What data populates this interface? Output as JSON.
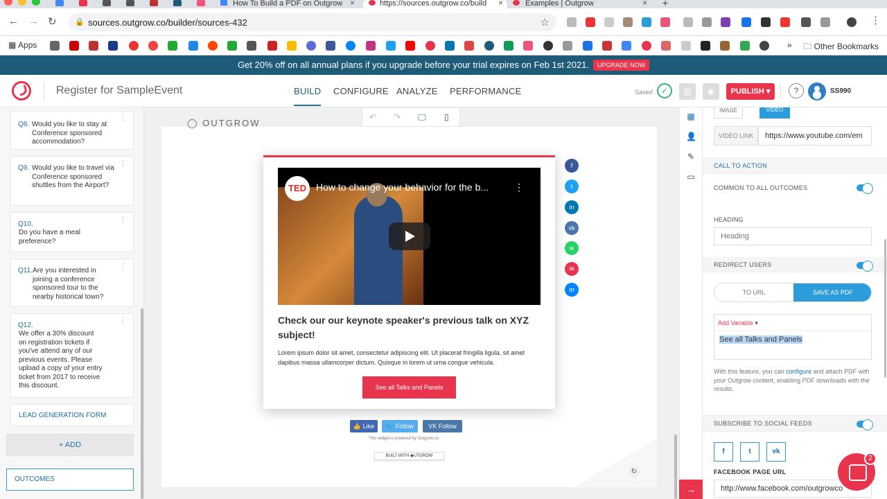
{
  "browser": {
    "tabs": [
      {
        "label": "How To Build a PDF on Outgrow"
      },
      {
        "label": "https://sources.outgrow.co/build"
      },
      {
        "label": "Examples | Outgrow"
      }
    ],
    "url": "sources.outgrow.co/builder/sources-432",
    "bookmarks_apps": "Apps",
    "bookmarks_other": "Other Bookmarks"
  },
  "promo": {
    "text": "Get 20% off on all annual plans if you upgrade before your trial expires on Feb 1st 2021.",
    "button": "UPGRADE NOW"
  },
  "header": {
    "title": "Register for SampleEvent",
    "tabs": [
      "BUILD",
      "CONFIGURE",
      "ANALYZE",
      "PERFORMANCE"
    ],
    "saved": "Saved",
    "publish": "PUBLISH ▾",
    "help": "?",
    "user": "SS990"
  },
  "sidebar": {
    "questions": [
      {
        "num": "Q8.",
        "text": "Would you like to stay at Conference sponsored accommodation?"
      },
      {
        "num": "Q9.",
        "text": "Would you like to travel via Conference sponsored shuttles from the Airport?"
      },
      {
        "num": "Q10.",
        "text": "Do you have a meal preference?"
      },
      {
        "num": "Q11.",
        "text": "Are you interested in joining a conference sponsored tour to the nearby historical town?"
      },
      {
        "num": "Q12.",
        "text": "We offer a 30% discount on registration tickets if you've attend any of our previous events. Please upload a copy of your entry ticket from 2017 to receive this discount."
      }
    ],
    "lead_form": "LEAD GENERATION FORM",
    "add": "+ ADD",
    "outcomes": "OUTCOMES"
  },
  "canvas": {
    "brand": "OUTGROW",
    "video_title": "How to change your behavior for the b...",
    "ted": "TED",
    "heading": "Check our our keynote speaker's previous talk on XYZ subject!",
    "body": "Lorem ipsum dolor sit amet, consectetur adipiscing elit. Ut placerat fringilla ligula, sit amet dapibus massa ullamcorper dictum. Quisque in lorem ut urna congue vehicula.",
    "cta": "See all Talks and Panels",
    "social_follow": [
      {
        "label": "👍 Like",
        "color": "#4267b2"
      },
      {
        "label": "🐦 Follow",
        "color": "#55acee"
      },
      {
        "label": "VK Follow",
        "color": "#4a76a8"
      }
    ],
    "powered": "This widget is powered by Outgrow.co",
    "built_with": "BUILT WITH ◉UTGROW",
    "share_icons": [
      {
        "icon": "facebook-icon",
        "glyph": "f",
        "color": "#3b5998"
      },
      {
        "icon": "twitter-icon",
        "glyph": "t",
        "color": "#1da1f2"
      },
      {
        "icon": "linkedin-icon",
        "glyph": "in",
        "color": "#0077b5"
      },
      {
        "icon": "vk-icon",
        "glyph": "vk",
        "color": "#4a76a8"
      },
      {
        "icon": "whatsapp-icon",
        "glyph": "w",
        "color": "#25d366"
      },
      {
        "icon": "email-icon",
        "glyph": "✉",
        "color": "#e8344c"
      },
      {
        "icon": "messenger-icon",
        "glyph": "m",
        "color": "#0084ff"
      }
    ]
  },
  "panel": {
    "media_tabs": [
      "IMAGE",
      "VIDEO"
    ],
    "video_link_label": "VIDEO LINK",
    "video_link": "https://www.youtube.com/em",
    "call_to_action": "CALL TO ACTION",
    "common_all": "COMMON TO ALL OUTCOMES",
    "heading_label": "HEADING",
    "heading_placeholder": "Heading",
    "redirect": "REDIRECT USERS",
    "seg_url": "TO URL",
    "seg_pdf": "SAVE AS PDF",
    "add_variable": "Add Variable",
    "pdf_text": "See all Talks and Panels",
    "help_pre": "With this feature, you can ",
    "help_link": "configure",
    "help_post": " and attach PDF with your Outgrow content, enabling PDF downloads with the results.",
    "subscribe": "SUBSCRIBE TO SOCIAL FEEDS",
    "fb_label": "FACEBOOK PAGE URL",
    "fb_url": "http://www.facebook.com/outgrowco",
    "social_boxes": [
      "f",
      "t",
      "vk"
    ]
  },
  "chat_badge": "2",
  "colors": {
    "accent": "#e8344c",
    "primary": "#1d5b79",
    "link": "#1d6fa5"
  }
}
